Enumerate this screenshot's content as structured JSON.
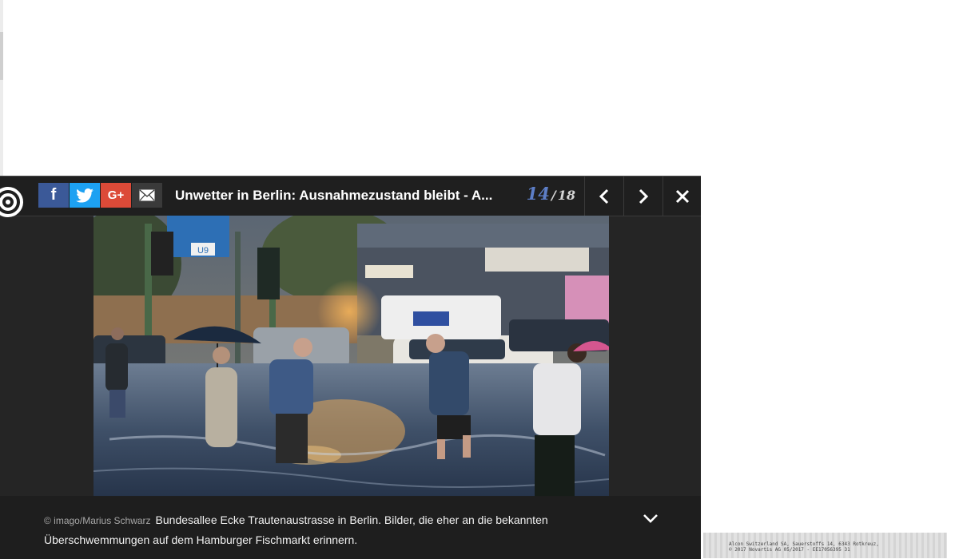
{
  "gallery": {
    "title": "Unwetter in Berlin: Ausnahmezustand bleibt - A...",
    "counter": {
      "current": "14",
      "separator": "/",
      "total": "18"
    },
    "share": {
      "facebook": "f",
      "googleplus": "G+"
    },
    "photo": {
      "sign_text": "U9",
      "credit": "© imago/Marius Schwarz",
      "caption": "Bundesallee Ecke Trautenaustrasse in Berlin. Bilder, die eher an die bekannten Überschwemmungen auf dem Hamburger Fischmarkt erinnern."
    }
  },
  "ad": {
    "line1": "Alcon Switzerland SA, Sauerstoffs 14, 6343 Rotkreuz,",
    "line2": "© 2017 Novartis AG 05/2017 - EE17056395 31"
  },
  "colors": {
    "facebook": "#3b5998",
    "twitter": "#1da1f2",
    "googleplus": "#dc4a38",
    "counter_accent": "#5d7ec7",
    "header_bg": "#1f1f1f"
  },
  "icons": [
    "facebook-icon",
    "twitter-icon",
    "google-plus-icon",
    "mail-icon",
    "chevron-left-icon",
    "chevron-right-icon",
    "close-icon",
    "chevron-down-icon",
    "brand-logo-icon"
  ]
}
